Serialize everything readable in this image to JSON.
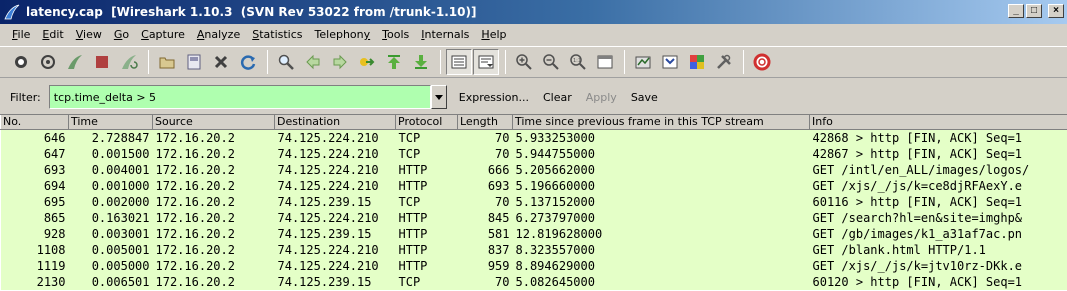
{
  "window": {
    "title": "latency.cap  [Wireshark 1.10.3  (SVN Rev 53022 from /trunk-1.10)]",
    "minimize": "_",
    "maximize": "□",
    "close": "×"
  },
  "menu": [
    {
      "label": "File",
      "mnemonic": "F",
      "rest": "ile"
    },
    {
      "label": "Edit",
      "mnemonic": "E",
      "rest": "dit"
    },
    {
      "label": "View",
      "mnemonic": "V",
      "rest": "iew"
    },
    {
      "label": "Go",
      "mnemonic": "G",
      "rest": "o"
    },
    {
      "label": "Capture",
      "mnemonic": "C",
      "rest": "apture"
    },
    {
      "label": "Analyze",
      "mnemonic": "A",
      "rest": "nalyze"
    },
    {
      "label": "Statistics",
      "mnemonic": "S",
      "rest": "tatistics"
    },
    {
      "label": "Telephony",
      "pre": "Telephon",
      "mnemonic": "y",
      "rest": ""
    },
    {
      "label": "Tools",
      "mnemonic": "T",
      "rest": "ools"
    },
    {
      "label": "Internals",
      "mnemonic": "I",
      "rest": "nternals"
    },
    {
      "label": "Help",
      "mnemonic": "H",
      "rest": "elp"
    }
  ],
  "toolbar_icons": [
    "interface-list-icon",
    "capture-options-icon",
    "start-capture-icon",
    "stop-capture-icon",
    "restart-capture-icon",
    "open-file-icon",
    "save-file-icon",
    "close-file-icon",
    "reload-icon",
    "find-icon",
    "go-back-icon",
    "go-forward-icon",
    "go-to-packet-icon",
    "first-packet-icon",
    "last-packet-icon",
    "colorize-icon",
    "auto-scroll-icon",
    "zoom-in-icon",
    "zoom-out-icon",
    "normal-size-icon",
    "resize-columns-icon",
    "capture-filters-icon",
    "display-filters-icon",
    "coloring-rules-icon",
    "preferences-icon",
    "help-icon"
  ],
  "filter": {
    "label": "Filter:",
    "value": "tcp.time_delta > 5",
    "expression": "Expression...",
    "clear": "Clear",
    "apply": "Apply",
    "save": "Save",
    "bg_color": "#afffaf"
  },
  "packet_list": {
    "columns": [
      "No.",
      "Time",
      "Source",
      "Destination",
      "Protocol",
      "Length",
      "Time since previous frame in this TCP stream",
      "Info"
    ],
    "row_color": "#e4ffc7",
    "rows": [
      [
        "646",
        "2.728847",
        "172.16.20.2",
        "74.125.224.210",
        "TCP",
        "70",
        "5.933253000",
        "42868 > http [FIN, ACK] Seq=1"
      ],
      [
        "647",
        "0.001500",
        "172.16.20.2",
        "74.125.224.210",
        "TCP",
        "70",
        "5.944755000",
        "42867 > http [FIN, ACK] Seq=1"
      ],
      [
        "693",
        "0.004001",
        "172.16.20.2",
        "74.125.224.210",
        "HTTP",
        "666",
        "5.205662000",
        "GET /intl/en_ALL/images/logos/"
      ],
      [
        "694",
        "0.001000",
        "172.16.20.2",
        "74.125.224.210",
        "HTTP",
        "693",
        "5.196660000",
        "GET /xjs/_/js/k=ce8djRFAexY.e"
      ],
      [
        "695",
        "0.002000",
        "172.16.20.2",
        "74.125.239.15",
        "TCP",
        "70",
        "5.137152000",
        "60116 > http [FIN, ACK] Seq=1"
      ],
      [
        "865",
        "0.163021",
        "172.16.20.2",
        "74.125.224.210",
        "HTTP",
        "845",
        "6.273797000",
        "GET /search?hl=en&site=imghp&"
      ],
      [
        "928",
        "0.003001",
        "172.16.20.2",
        "74.125.239.15",
        "HTTP",
        "581",
        "12.819628000",
        "GET /gb/images/k1_a31af7ac.pn"
      ],
      [
        "1108",
        "0.005001",
        "172.16.20.2",
        "74.125.224.210",
        "HTTP",
        "837",
        "8.323557000",
        "GET /blank.html HTTP/1.1"
      ],
      [
        "1119",
        "0.005000",
        "172.16.20.2",
        "74.125.224.210",
        "HTTP",
        "959",
        "8.894629000",
        "GET /xjs/_/js/k=jtv10rz-DKk.e"
      ],
      [
        "2130",
        "0.006501",
        "172.16.20.2",
        "74.125.239.15",
        "TCP",
        "70",
        "5.082645000",
        "60120 > http [FIN, ACK] Seq=1"
      ]
    ]
  }
}
